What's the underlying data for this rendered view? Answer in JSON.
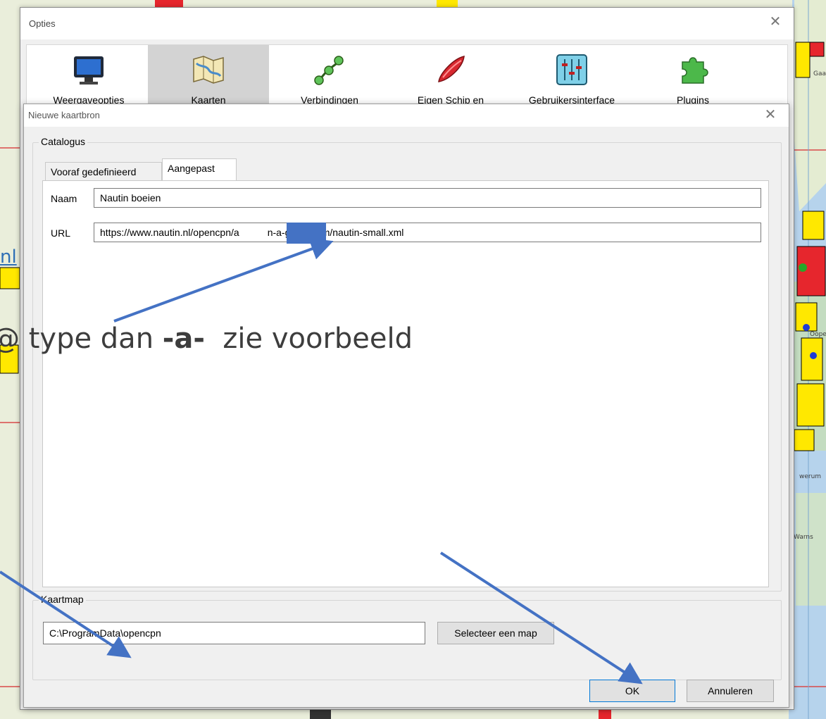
{
  "background": {
    "instruction_parts": {
      "prefix": "@ type dan ",
      "emph": "-a-",
      "suffix": "  zie voorbeeld"
    },
    "link_fragment": "nl",
    "map_labels": [
      "Gaa",
      "Ooper",
      "werum",
      "Warns"
    ]
  },
  "opties": {
    "title": "Opties",
    "close_glyph": "✕",
    "toolbar": [
      {
        "label": "Weergaveopties",
        "icon": "monitor-icon"
      },
      {
        "label": "Kaarten",
        "icon": "map-icon"
      },
      {
        "label": "Verbindingen",
        "icon": "connections-icon"
      },
      {
        "label": "Eigen Schip en",
        "icon": "boat-icon"
      },
      {
        "label": "Gebruikersinterface",
        "icon": "sliders-icon"
      },
      {
        "label": "Plugins",
        "icon": "puzzle-icon"
      }
    ]
  },
  "dialog": {
    "title": "Nieuwe kaartbron",
    "close_glyph": "✕",
    "catalog_group": "Catalogus",
    "tabs": [
      "Vooraf gedefinieerd",
      "Aangepast"
    ],
    "active_tab": "Aangepast",
    "fields": {
      "name_label": "Naam",
      "name_value": "Nautin boeien",
      "url_label": "URL",
      "url_value_start": "https://www.nautin.nl/opencpn/a",
      "url_value_end": "n-a-gmail.com/nautin-small.xml"
    },
    "folder_group": "Kaartmap",
    "folder_value": "C:\\ProgramData\\opencpn",
    "select_folder_button": "Selecteer een map",
    "ok_button": "OK",
    "cancel_button": "Annuleren"
  },
  "colors": {
    "annotation_arrow": "#4472c4",
    "default_button_border": "#0078d7"
  }
}
